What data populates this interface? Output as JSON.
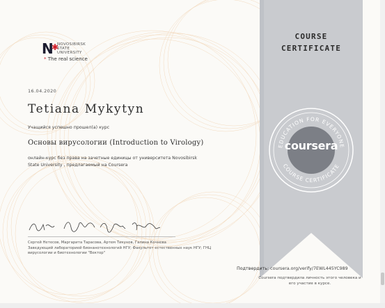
{
  "university": {
    "logo_mark": "N",
    "logo_lines": [
      "NOVOSIBIRSK",
      "STATE",
      "UNIVERSITY"
    ],
    "tagline": "The real science",
    "tagline_star": "*"
  },
  "certificate": {
    "date": "16.04.2020",
    "recipient": "Tetiana Mykytyn",
    "completed_text": "Учащийся успешно прошел(а) курс",
    "course_title": "Основы вирусологии (Introduction to Virology)",
    "description": "онлайн-курс без права на зачетные единицы от университета Novosibirsk State University , предлагаемый на Coursera",
    "instructors": "Сергей Нетесов, Маргарита Тарасова, Артем Тикунов, Галина Кочнева",
    "instructors_title": "Заведующий лабораторией бионанотехнологий НГУ; Факультет естественных наук НГУ; ГНЦ вирусологии и биотехнологии \"Вектор\""
  },
  "ribbon": {
    "title_line1": "COURSE",
    "title_line2": "CERTIFICATE",
    "seal_brand": "coursera",
    "seal_top_text": "EDUCATION FOR EVERYONE",
    "seal_bottom_text": "COURSE CERTIFICATE"
  },
  "verification": {
    "label": "Подтвердить:",
    "url": "coursera.org/verify/7EWL445YC989",
    "note": "Coursera подтвердила личность этого человека и его участие в курсе."
  },
  "colors": {
    "ribbon": "#c9cbcf",
    "ribbon_dark": "#a9acb2",
    "guilloche": "#f1d4b4",
    "brand_red": "#d3202a"
  }
}
